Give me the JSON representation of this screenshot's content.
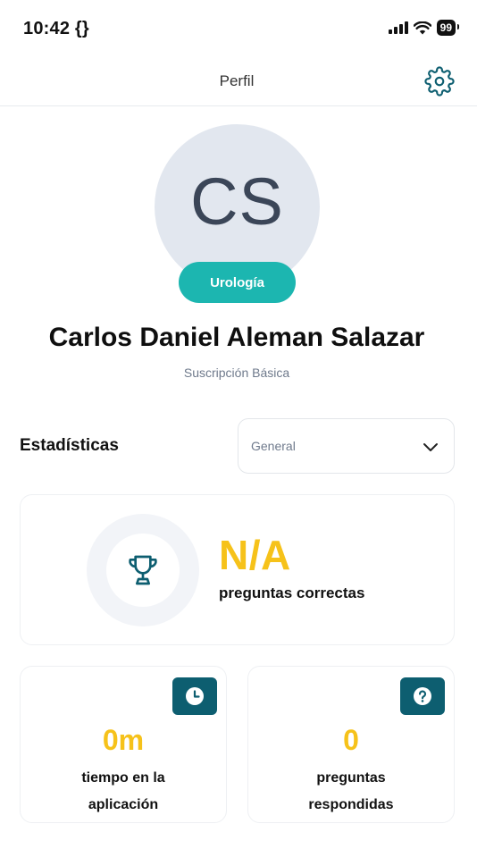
{
  "status_bar": {
    "time": "10:42 {}",
    "battery": "99"
  },
  "nav": {
    "title": "Perfil",
    "settings_icon": "gear-icon"
  },
  "profile": {
    "initials": "CS",
    "specialty": "Urología",
    "name": "Carlos Daniel Aleman Salazar",
    "subscription": "Suscripción Básica"
  },
  "stats": {
    "title": "Estadísticas",
    "filter_value": "General",
    "correct": {
      "value": "N/A",
      "label": "preguntas correctas",
      "icon": "trophy-icon"
    },
    "time_in_app": {
      "value": "0m",
      "label_line1": "tiempo en la",
      "label_line2": "aplicación",
      "icon": "clock-icon"
    },
    "answered": {
      "value": "0",
      "label_line1": "preguntas",
      "label_line2": "respondidas",
      "icon": "question-icon"
    }
  },
  "colors": {
    "accent_teal": "#1cb6b0",
    "icon_bg": "#0d5e70",
    "value_yellow": "#f6c21a",
    "avatar_bg": "#e2e7ef"
  }
}
